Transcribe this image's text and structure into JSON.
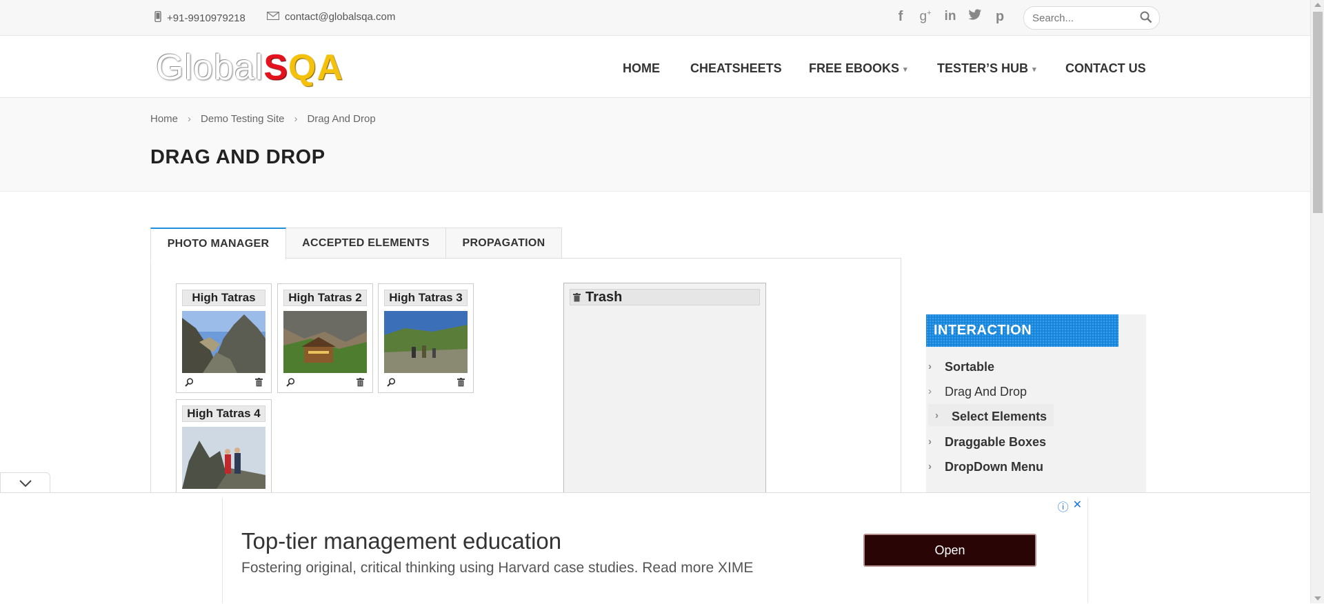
{
  "topbar": {
    "phone": "+91-9910979218",
    "email": "contact@globalsqa.com",
    "social_icons": [
      "facebook-icon",
      "google-plus-icon",
      "linkedin-icon",
      "twitter-icon",
      "pinterest-icon"
    ],
    "search_placeholder": "Search..."
  },
  "logo": {
    "part1": "Global",
    "part2": "S",
    "part3": "QA"
  },
  "nav": {
    "home": "HOME",
    "cheatsheets": "CHEATSHEETS",
    "free_ebooks": "FREE EBOOKS",
    "testers_hub": "TESTER’S HUB",
    "contact_us": "CONTACT US"
  },
  "breadcrumb": {
    "home": "Home",
    "demo": "Demo Testing Site",
    "current": "Drag And Drop"
  },
  "page_title": "DRAG AND DROP",
  "tabs": [
    "PHOTO MANAGER",
    "ACCEPTED ELEMENTS",
    "PROPAGATION"
  ],
  "photos": [
    "High Tatras",
    "High Tatras 2",
    "High Tatras 3",
    "High Tatras 4"
  ],
  "trash_label": "Trash",
  "sidebar": {
    "heading": "INTERACTION",
    "items": [
      "Sortable",
      "Drag And Drop",
      "Select Elements",
      "Draggable Boxes",
      "DropDown Menu"
    ]
  },
  "ad": {
    "title": "Top-tier management education",
    "subtitle": "Fostering original, critical thinking using Harvard case studies. Read more XIME",
    "button": "Open"
  },
  "colors": {
    "accent": "#1684d8",
    "ad_button": "#2a0505"
  }
}
